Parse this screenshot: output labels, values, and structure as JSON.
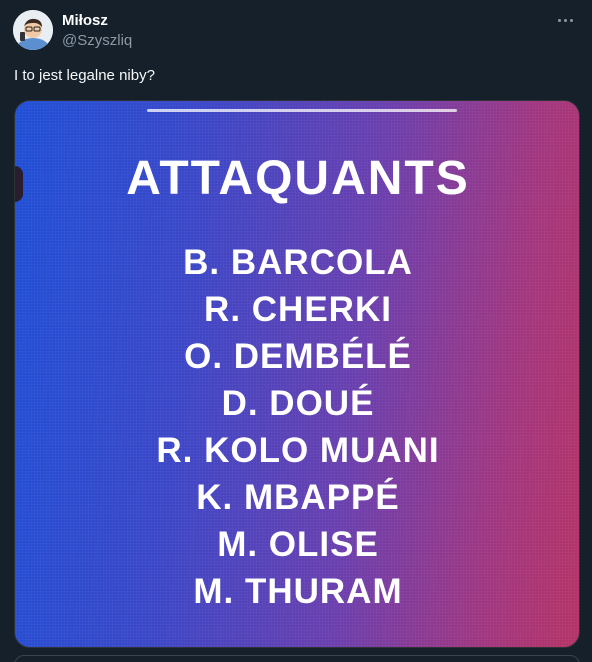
{
  "author": {
    "display_name": "Miłosz",
    "handle": "@Szyszliq",
    "avatar_icon": "cartoon-avatar-icon"
  },
  "more_icon": "more-options-icon",
  "tweet": {
    "text": "I to jest legalne niby?"
  },
  "media": {
    "title": "ATTAQUANTS",
    "players": [
      "B. BARCOLA",
      "R. CHERKI",
      "O. DEMBÉLÉ",
      "D. DOUÉ",
      "R. KOLO MUANI",
      "K. MBAPPÉ",
      "M. OLISE",
      "M. THURAM"
    ],
    "gradient_colors": [
      "#1f4fd6",
      "#6a3fae",
      "#b43366"
    ]
  },
  "colors": {
    "background": "#15202b",
    "secondary_text": "#8b98a5"
  }
}
